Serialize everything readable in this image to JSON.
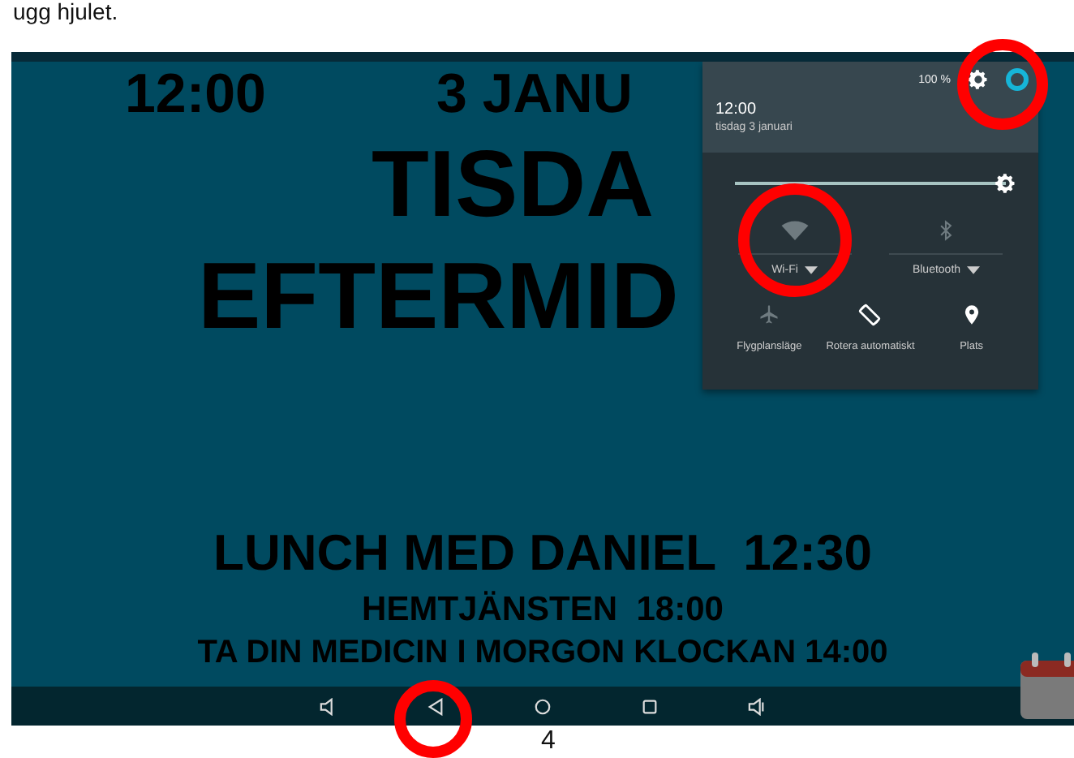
{
  "document": {
    "caption_fragment": "ugg hjulet.",
    "page_number": "4"
  },
  "screen": {
    "clock": "12:00",
    "date": "3 JANU",
    "weekday": "TISDA",
    "daypart": "EFTERMID",
    "events": [
      "LUNCH MED DANIEL  12:30",
      "HEMTJÄNSTEN  18:00",
      "TA DIN MEDICIN I MORGON KLOCKAN 14:00"
    ]
  },
  "quick_settings": {
    "battery": "100 %",
    "time": "12:00",
    "date": "tisdag 3 januari",
    "brightness": {
      "level": 1
    },
    "tiles": [
      {
        "kind": "wifi",
        "label": "Wi-Fi",
        "on": false,
        "has_menu": true
      },
      {
        "kind": "bluetooth",
        "label": "Bluetooth",
        "on": false,
        "has_menu": true
      }
    ],
    "toggles": [
      {
        "kind": "airplane",
        "label": "Flygplansläge",
        "on": false
      },
      {
        "kind": "rotate",
        "label": "Rotera automatiskt",
        "on": true
      },
      {
        "kind": "location",
        "label": "Plats",
        "on": true
      }
    ]
  }
}
